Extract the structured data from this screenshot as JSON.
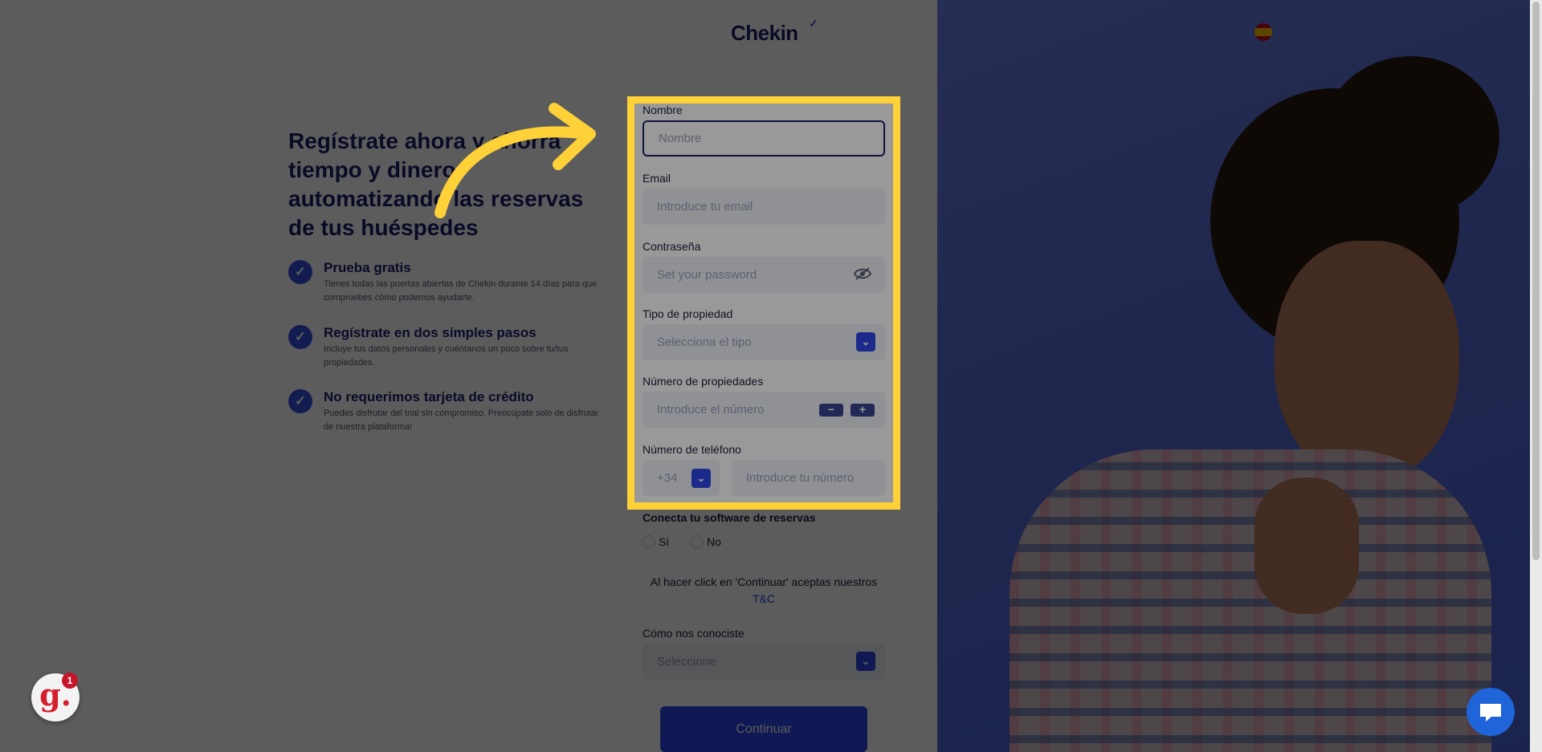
{
  "brand": {
    "name": "Chekin"
  },
  "headline": "Regístrate ahora y ahorra tiempo y dinero automatizando las reservas de tus huéspedes",
  "benefits": [
    {
      "title": "Prueba gratis",
      "desc": "Tienes todas las puertas abiertas de Chekin durante 14 días para que compruebes cómo podemos ayudarte."
    },
    {
      "title": "Regístrate en dos simples pasos",
      "desc": "Incluye tus datos personales y cuéntanos un poco sobre tu/tus propiedades."
    },
    {
      "title": "No requerimos tarjeta de crédito",
      "desc": "Puedes disfrutar del trial sin compromiso. Preocúpate solo de disfrutar de nuestra plataforma!"
    }
  ],
  "form": {
    "nombre": {
      "label": "Nombre",
      "placeholder": "Nombre"
    },
    "email": {
      "label": "Email",
      "placeholder": "Introduce tu email"
    },
    "password": {
      "label": "Contraseña",
      "placeholder": "Set your password"
    },
    "property_type": {
      "label": "Tipo de propiedad",
      "placeholder": "Selecciona el tipo"
    },
    "property_count": {
      "label": "Número de propiedades",
      "placeholder": "Introduce el número",
      "minus": "−",
      "plus": "+"
    },
    "phone": {
      "label": "Número de teléfono",
      "prefix": "+34",
      "placeholder": "Introduce tu número"
    },
    "software": {
      "label": "Conecta tu software de reservas",
      "options": [
        "Sí",
        "No"
      ]
    },
    "terms": {
      "text": "Al hacer click en 'Continuar' aceptas nuestros",
      "link": "T&C"
    },
    "how_found": {
      "label": "Cómo nos conociste",
      "placeholder": "Seleccione"
    },
    "submit": "Continuar"
  },
  "widgets": {
    "g_badge": "1",
    "g_logo": "g."
  },
  "colors": {
    "accent": "#2f48e8",
    "navy": "#1a1f6b",
    "highlight": "#fdd137"
  }
}
